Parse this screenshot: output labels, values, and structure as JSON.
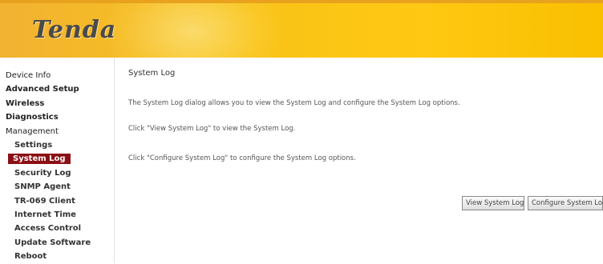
{
  "brand": {
    "logo_text": "Tenda"
  },
  "sidebar": {
    "items": [
      {
        "label": "Device Info"
      },
      {
        "label": "Advanced Setup"
      },
      {
        "label": "Wireless"
      },
      {
        "label": "Diagnostics"
      },
      {
        "label": "Management"
      },
      {
        "label": "Settings"
      },
      {
        "label": "System Log",
        "active": true
      },
      {
        "label": "Security Log"
      },
      {
        "label": "SNMP Agent"
      },
      {
        "label": "TR-069 Client"
      },
      {
        "label": "Internet Time"
      },
      {
        "label": "Access Control"
      },
      {
        "label": "Update Software"
      },
      {
        "label": "Reboot"
      }
    ]
  },
  "main": {
    "title": "System Log",
    "description": "The System Log dialog allows you to view the System Log and configure the System Log options.",
    "hint_view": "Click \"View System Log\" to view the System Log.",
    "hint_configure": "Click \"Configure System Log\" to configure the System Log options.",
    "buttons": {
      "view": "View System Log",
      "configure": "Configure System Log"
    }
  },
  "colors": {
    "header_accent": "#f7c21a",
    "active_item_bg": "#8b0f14"
  }
}
